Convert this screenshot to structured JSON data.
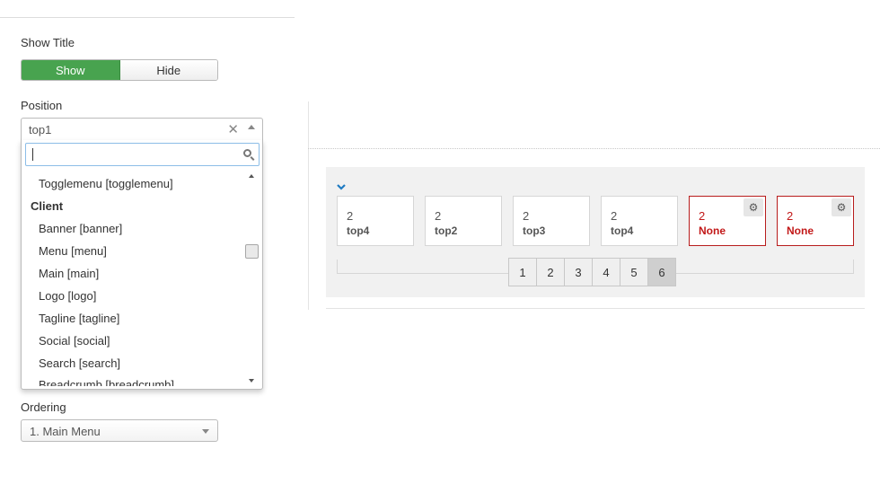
{
  "show_title": {
    "label": "Show Title",
    "show": "Show",
    "hide": "Hide",
    "selected": "Show"
  },
  "position": {
    "label": "Position",
    "value": "top1",
    "clear": "✕",
    "search_placeholder": "",
    "items": [
      {
        "type": "item",
        "text": "Togglemenu [togglemenu]"
      },
      {
        "type": "group",
        "text": "Client"
      },
      {
        "type": "item",
        "text": "Banner [banner]"
      },
      {
        "type": "item",
        "text": "Menu [menu]"
      },
      {
        "type": "item",
        "text": "Main [main]"
      },
      {
        "type": "item",
        "text": "Logo [logo]"
      },
      {
        "type": "item",
        "text": "Tagline [tagline]"
      },
      {
        "type": "item",
        "text": "Social [social]"
      },
      {
        "type": "item",
        "text": "Search [search]"
      },
      {
        "type": "item",
        "text": "Breadcrumb [breadcrumb]"
      }
    ]
  },
  "ordering": {
    "label": "Ordering",
    "value": "1. Main Menu"
  },
  "modules": [
    {
      "count": "2",
      "position": "top4",
      "state": "normal"
    },
    {
      "count": "2",
      "position": "top2",
      "state": "normal"
    },
    {
      "count": "2",
      "position": "top3",
      "state": "normal"
    },
    {
      "count": "2",
      "position": "top4",
      "state": "normal"
    },
    {
      "count": "2",
      "position": "None",
      "state": "error"
    },
    {
      "count": "2",
      "position": "None",
      "state": "error"
    }
  ],
  "pagination": {
    "pages": [
      "1",
      "2",
      "3",
      "4",
      "5",
      "6"
    ],
    "active": "6"
  },
  "colors": {
    "accent_green": "#48a34f",
    "error_red": "#c21818",
    "chevron_blue": "#1f7bc2"
  },
  "icons": {
    "collapse": "chevron-down-icon",
    "settings": "gear-icon",
    "search": "search-icon",
    "clear": "close-icon"
  }
}
